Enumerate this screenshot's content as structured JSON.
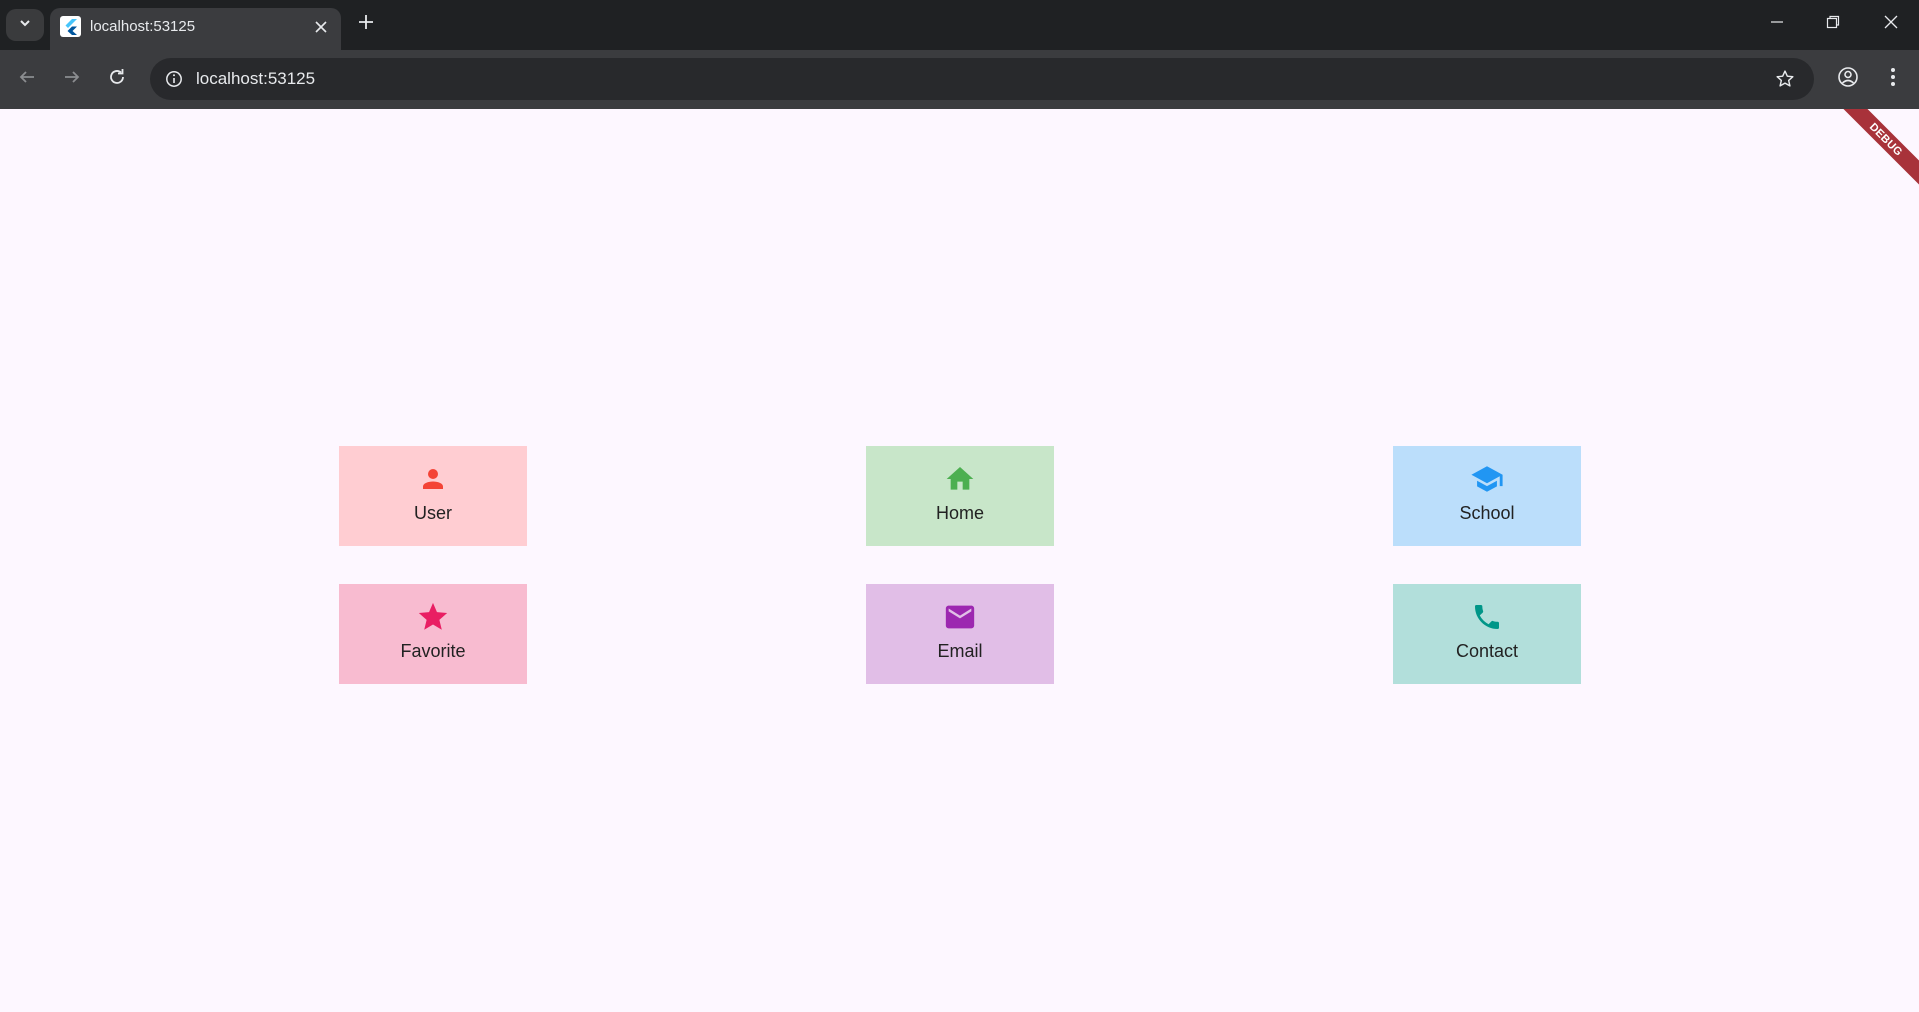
{
  "browser": {
    "tab_title": "localhost:53125",
    "url": "localhost:53125"
  },
  "app": {
    "debug_banner": "DEBUG",
    "cards": [
      {
        "label": "User",
        "icon": "person-icon",
        "bg": "#ffcdd2",
        "fg": "#f44336"
      },
      {
        "label": "Home",
        "icon": "home-icon",
        "bg": "#c8e6c9",
        "fg": "#4caf50"
      },
      {
        "label": "School",
        "icon": "school-icon",
        "bg": "#bbdefb",
        "fg": "#2196f3"
      },
      {
        "label": "Favorite",
        "icon": "star-icon",
        "bg": "#f8bbd0",
        "fg": "#e91e63"
      },
      {
        "label": "Email",
        "icon": "email-icon",
        "bg": "#e1bee7",
        "fg": "#9c27b0"
      },
      {
        "label": "Contact",
        "icon": "phone-icon",
        "bg": "#b2dfdb",
        "fg": "#009688"
      }
    ]
  }
}
